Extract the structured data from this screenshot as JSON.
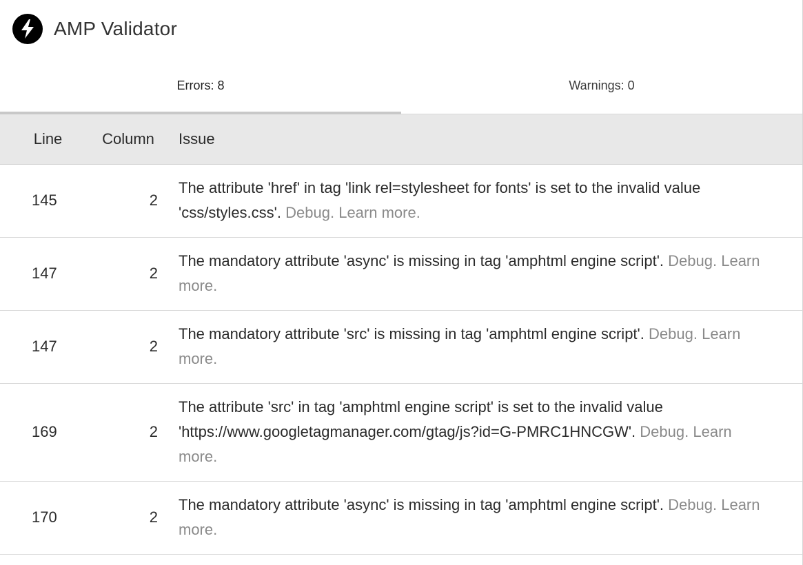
{
  "header": {
    "title": "AMP Validator"
  },
  "tabs": [
    {
      "label": "Errors: 8",
      "active": true
    },
    {
      "label": "Warnings: 0",
      "active": false
    }
  ],
  "table": {
    "headers": {
      "line": "Line",
      "column": "Column",
      "issue": "Issue"
    },
    "rows": [
      {
        "line": "145",
        "column": "2",
        "message": "The attribute 'href' in tag 'link rel=stylesheet for fonts' is set to the invalid value 'css/styles.css'.",
        "debug": "Debug",
        "learn": "Learn more"
      },
      {
        "line": "147",
        "column": "2",
        "message": "The mandatory attribute 'async' is missing in tag 'amphtml engine script'.",
        "debug": "Debug",
        "learn": "Learn more"
      },
      {
        "line": "147",
        "column": "2",
        "message": "The mandatory attribute 'src' is missing in tag 'amphtml engine script'.",
        "debug": "Debug",
        "learn": "Learn more"
      },
      {
        "line": "169",
        "column": "2",
        "message": "The attribute 'src' in tag 'amphtml engine script' is set to the invalid value 'https://www.googletagmanager.com/gtag/js?id=G-PMRC1HNCGW'.",
        "debug": "Debug",
        "learn": "Learn more"
      },
      {
        "line": "170",
        "column": "2",
        "message": "The mandatory attribute 'async' is missing in tag 'amphtml engine script'.",
        "debug": "Debug",
        "learn": "Learn more"
      }
    ]
  },
  "colors": {
    "link": "#8a8a8a",
    "header_bg": "#e8e8e8",
    "tab_indicator": "#c8c8c8"
  },
  "icons": {
    "logo": "amp-lightning-bolt-icon"
  }
}
